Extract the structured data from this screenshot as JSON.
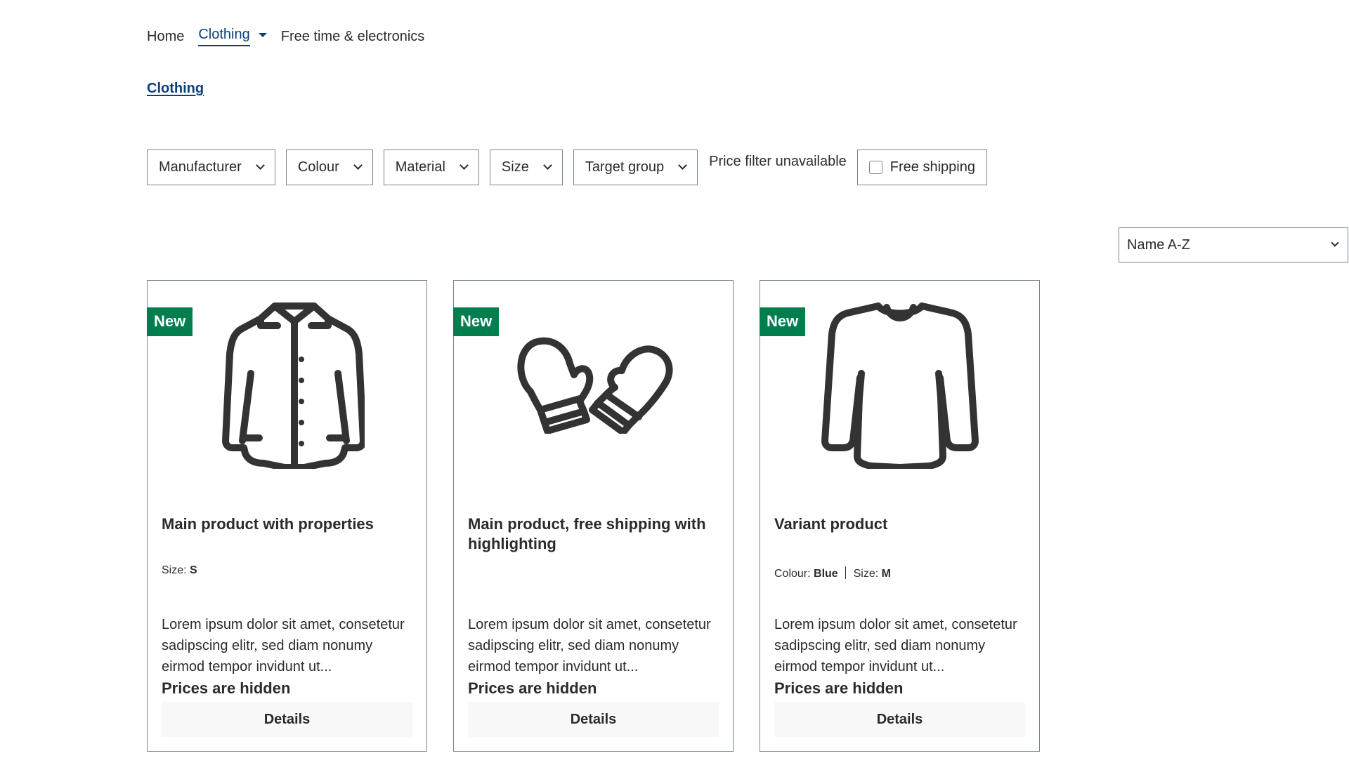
{
  "nav": {
    "items": [
      {
        "label": "Home"
      },
      {
        "label": "Clothing"
      },
      {
        "label": "Free time & electronics"
      }
    ]
  },
  "breadcrumb": {
    "label": "Clothing"
  },
  "filters": {
    "manufacturer": "Manufacturer",
    "colour": "Colour",
    "material": "Material",
    "size": "Size",
    "target_group": "Target group",
    "price_note": "Price filter unavailable",
    "free_shipping": "Free shipping"
  },
  "sort": {
    "selected": "Name A-Z"
  },
  "colors": {
    "accent": "#0b3f7a",
    "badge": "#007e4e",
    "border": "#798490",
    "text": "#2b2b2b",
    "button_bg": "#f8f8f8"
  },
  "products": [
    {
      "badge": "New",
      "icon": "jacket-icon",
      "title": "Main product with properties",
      "props": [
        {
          "label": "Size:",
          "value": "S"
        }
      ],
      "description": "Lorem ipsum dolor sit amet, consetetur sadipscing elitr, sed diam nonumy eirmod tempor invidunt ut...",
      "price": "Prices are hidden",
      "button": "Details"
    },
    {
      "badge": "New",
      "icon": "mittens-icon",
      "title": "Main product, free shipping with highlighting",
      "props": [],
      "description": "Lorem ipsum dolor sit amet, consetetur sadipscing elitr, sed diam nonumy eirmod tempor invidunt ut...",
      "price": "Prices are hidden",
      "button": "Details"
    },
    {
      "badge": "New",
      "icon": "sweater-icon",
      "title": "Variant product",
      "props": [
        {
          "label": "Colour:",
          "value": "Blue"
        },
        {
          "label": "Size:",
          "value": "M"
        }
      ],
      "description": "Lorem ipsum dolor sit amet, consetetur sadipscing elitr, sed diam nonumy eirmod tempor invidunt ut...",
      "price": "Prices are hidden",
      "button": "Details"
    }
  ]
}
